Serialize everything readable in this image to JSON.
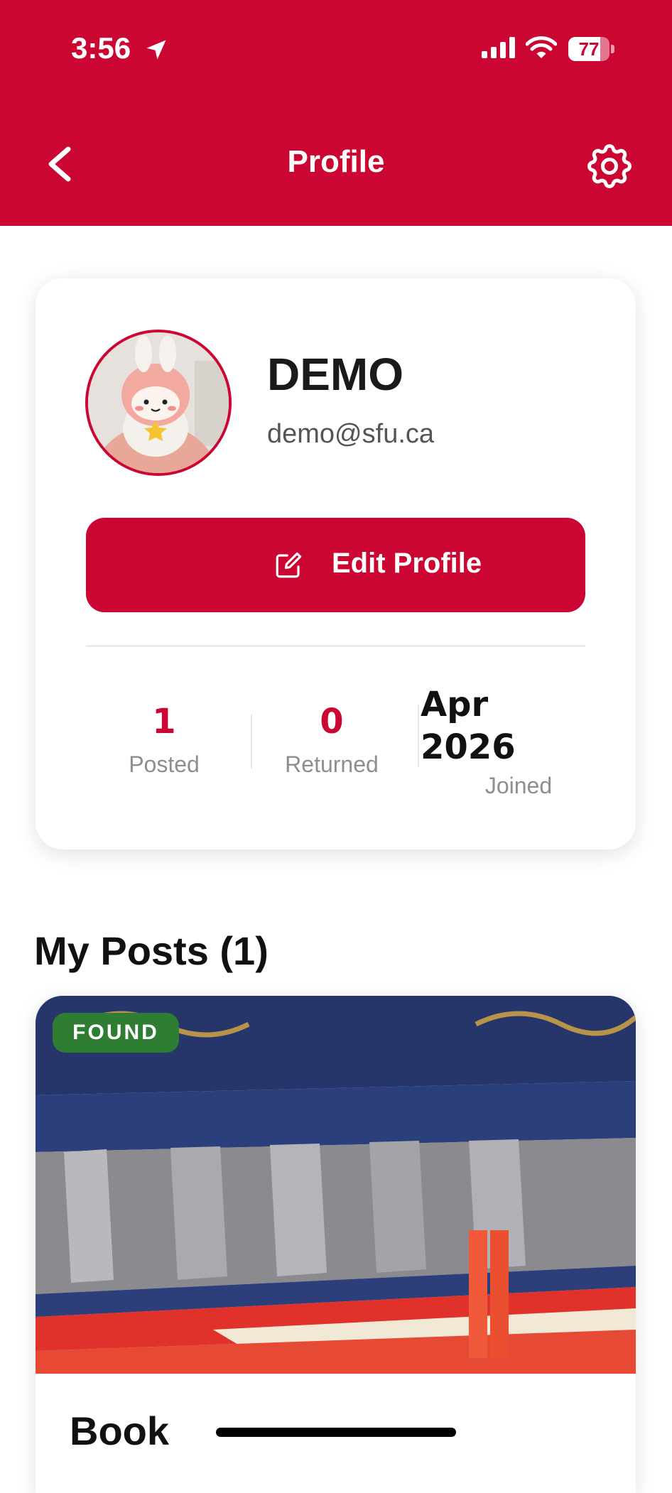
{
  "status_bar": {
    "time": "3:56",
    "battery": "77",
    "battery_level": 0.77
  },
  "header": {
    "title": "Profile"
  },
  "profile": {
    "name": "DEMO",
    "email": "demo@sfu.ca",
    "edit_label": "Edit Profile",
    "stats": [
      {
        "value": "1",
        "label": "Posted"
      },
      {
        "value": "0",
        "label": "Returned"
      },
      {
        "value_line1": "Apr",
        "value_line2": "2026",
        "label": "Joined"
      }
    ]
  },
  "posts": {
    "section_title": "My Posts (1)",
    "items": [
      {
        "badge": "FOUND",
        "title": "Book"
      }
    ]
  },
  "colors": {
    "brand": "#CC0633",
    "found_badge": "#2E7D32"
  },
  "icons": [
    "location-arrow-icon",
    "signal-icon",
    "wifi-icon",
    "battery-icon",
    "back-icon",
    "settings-gear-icon",
    "edit-icon"
  ]
}
